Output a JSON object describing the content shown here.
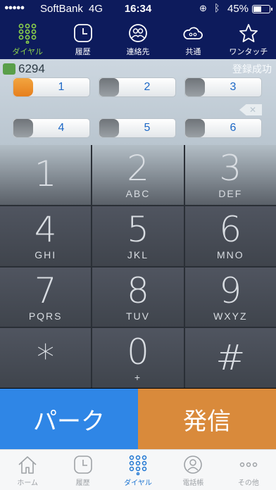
{
  "status_bar": {
    "signal": "●●●●●",
    "carrier": "SoftBank",
    "network": "4G",
    "time": "16:34",
    "battery": "45%",
    "battery_level": 0.45
  },
  "top_tabs": [
    {
      "label": "ダイヤル",
      "icon": "keypad-icon",
      "active": true
    },
    {
      "label": "履歴",
      "icon": "clock-icon",
      "active": false
    },
    {
      "label": "連絡先",
      "icon": "contacts-icon",
      "active": false
    },
    {
      "label": "共通",
      "icon": "cloud-group-icon",
      "active": false
    },
    {
      "label": "ワンタッチ",
      "icon": "star-icon",
      "active": false
    }
  ],
  "number_display": {
    "current_number": "6294",
    "status": "登録成功"
  },
  "memory_keys": [
    {
      "label": "1",
      "active": true
    },
    {
      "label": "2",
      "active": false
    },
    {
      "label": "3",
      "active": false
    },
    {
      "label": "4",
      "active": false
    },
    {
      "label": "5",
      "active": false
    },
    {
      "label": "6",
      "active": false
    }
  ],
  "keypad": [
    {
      "digit": "1",
      "letters": ""
    },
    {
      "digit": "2",
      "letters": "ABC"
    },
    {
      "digit": "3",
      "letters": "DEF"
    },
    {
      "digit": "4",
      "letters": "GHI"
    },
    {
      "digit": "5",
      "letters": "JKL"
    },
    {
      "digit": "6",
      "letters": "MNO"
    },
    {
      "digit": "7",
      "letters": "PQRS"
    },
    {
      "digit": "8",
      "letters": "TUV"
    },
    {
      "digit": "9",
      "letters": "WXYZ"
    },
    {
      "digit": "*",
      "letters": ""
    },
    {
      "digit": "0",
      "letters": "+"
    },
    {
      "digit": "#",
      "letters": ""
    }
  ],
  "actions": {
    "park_label": "パーク",
    "call_label": "発信",
    "park_color": "#2f86e6",
    "call_color": "#d98a3b"
  },
  "bottom_tabs": [
    {
      "label": "ホーム",
      "icon": "home-icon",
      "active": false
    },
    {
      "label": "履歴",
      "icon": "clock-icon",
      "active": false
    },
    {
      "label": "ダイヤル",
      "icon": "keypad-icon",
      "active": true
    },
    {
      "label": "電話帳",
      "icon": "contact-icon",
      "active": false
    },
    {
      "label": "その他",
      "icon": "more-icon",
      "active": false
    }
  ]
}
